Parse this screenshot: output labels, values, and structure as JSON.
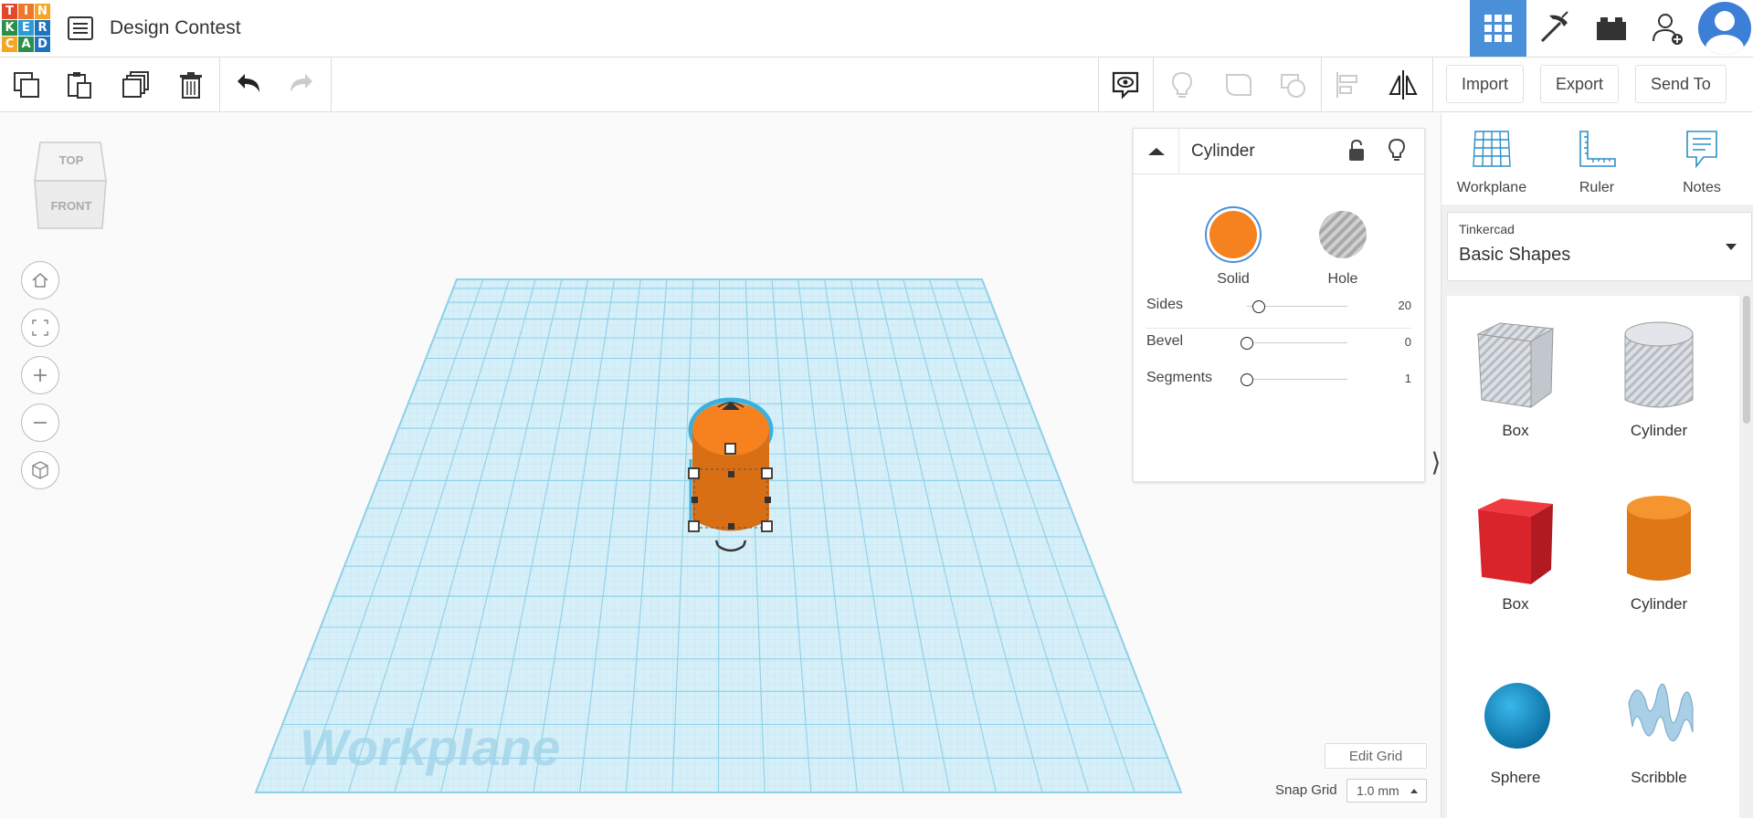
{
  "logo": {
    "letters": [
      "T",
      "I",
      "N",
      "K",
      "E",
      "R",
      "C",
      "A",
      "D"
    ],
    "colors": [
      "#e2482c",
      "#f0762b",
      "#f5a623",
      "#2a8f4c",
      "#2c9ad8",
      "#1e73be",
      "#f5a623",
      "#2a8f4c",
      "#1e73be"
    ]
  },
  "header": {
    "title": "Design Contest",
    "icons": [
      "project-list-icon",
      "grid-view-icon",
      "pickaxe-icon",
      "bricks-icon",
      "add-user-icon",
      "avatar"
    ]
  },
  "toolbar": {
    "left_icons": [
      "copy-icon",
      "paste-icon",
      "duplicate-icon",
      "delete-icon",
      "undo-icon",
      "redo-icon"
    ],
    "right_icons": [
      "notes-toggle-icon",
      "lightbulb-icon",
      "group-icon",
      "ungroup-icon",
      "align-icon",
      "mirror-icon"
    ],
    "import_label": "Import",
    "export_label": "Export",
    "send_to_label": "Send To"
  },
  "viewcube": {
    "top_label": "TOP",
    "front_label": "FRONT"
  },
  "nav_controls": [
    "home-view-icon",
    "fit-view-icon",
    "zoom-in-icon",
    "zoom-out-icon",
    "ortho-view-icon"
  ],
  "workplane": {
    "watermark": "Workplane",
    "edit_grid_label": "Edit Grid",
    "snap_grid_label": "Snap Grid",
    "snap_grid_value": "1.0 mm"
  },
  "inspector": {
    "title": "Cylinder",
    "solid_label": "Solid",
    "hole_label": "Hole",
    "solid_color": "#f5821f",
    "props": [
      {
        "label": "Sides",
        "value": "20",
        "level": 0.12
      },
      {
        "label": "Bevel",
        "value": "0",
        "level": 0
      },
      {
        "label": "Segments",
        "value": "1",
        "level": 0
      }
    ]
  },
  "right_panel": {
    "tools": [
      {
        "label": "Workplane",
        "icon": "workplane-icon"
      },
      {
        "label": "Ruler",
        "icon": "ruler-icon"
      },
      {
        "label": "Notes",
        "icon": "notes-icon"
      }
    ],
    "library_group": "Tinkercad",
    "library_name": "Basic Shapes",
    "shapes": [
      {
        "label": "Box",
        "kind": "box-hole"
      },
      {
        "label": "Cylinder",
        "kind": "cylinder-hole"
      },
      {
        "label": "Box",
        "kind": "box-red"
      },
      {
        "label": "Cylinder",
        "kind": "cylinder-orange"
      },
      {
        "label": "Sphere",
        "kind": "sphere"
      },
      {
        "label": "Scribble",
        "kind": "scribble"
      }
    ]
  },
  "colors": {
    "accent": "#4a90d9",
    "grid": "#a7dcee",
    "orange": "#f5821f",
    "red": "#d9242b",
    "sphere": "#1591c9"
  }
}
